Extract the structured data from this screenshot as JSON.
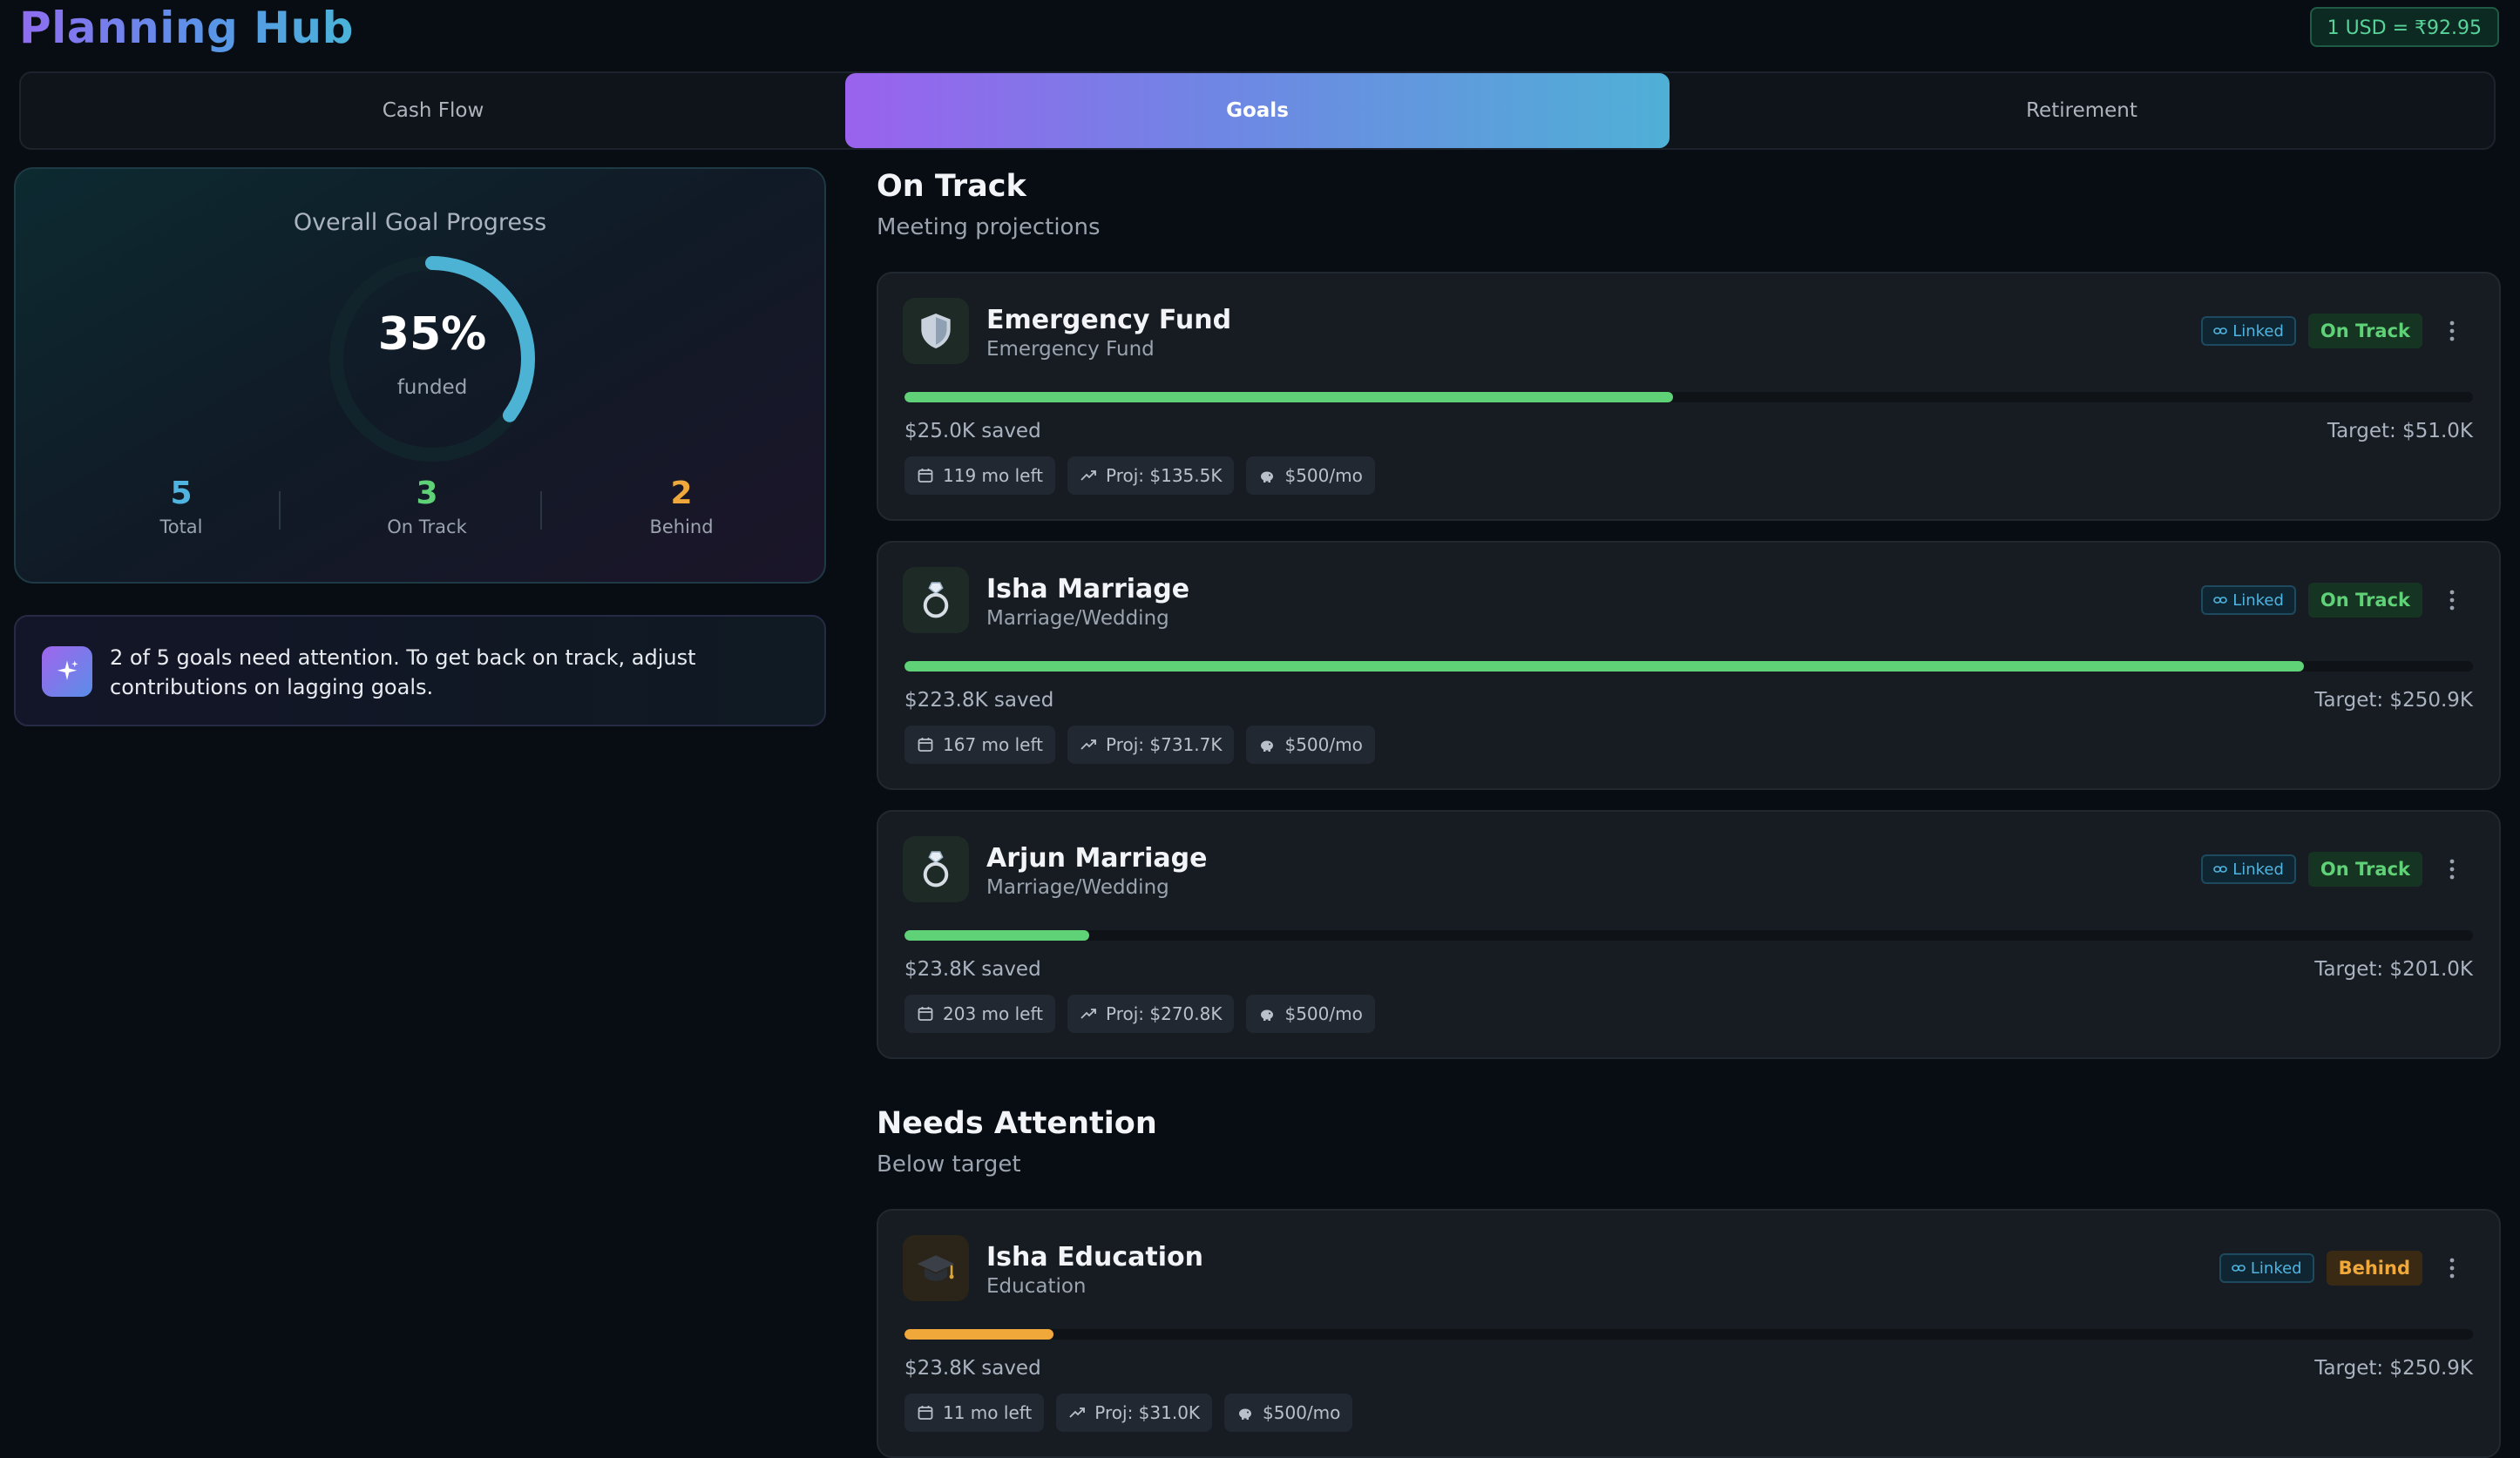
{
  "app": {
    "title": "Planning Hub",
    "fx_rate": "1 USD = ₹92.95"
  },
  "tabs": [
    {
      "label": "Cash Flow",
      "active": false
    },
    {
      "label": "Goals",
      "active": true
    },
    {
      "label": "Retirement",
      "active": false
    }
  ],
  "overview": {
    "title": "Overall Goal Progress",
    "percent_label": "35%",
    "percent_value": 35,
    "funded_label": "funded",
    "stats": [
      {
        "value": "5",
        "label": "Total",
        "color": "#4fb4e0"
      },
      {
        "value": "3",
        "label": "On Track",
        "color": "#5fd177"
      },
      {
        "value": "2",
        "label": "Behind",
        "color": "#f0a83a"
      }
    ]
  },
  "insight": {
    "text": "2 of 5 goals need attention. To get back on track, adjust contributions on lagging goals."
  },
  "sections": {
    "on_track": {
      "title": "On Track",
      "subtitle": "Meeting projections"
    },
    "attention": {
      "title": "Needs Attention",
      "subtitle": "Below target"
    }
  },
  "goals": [
    {
      "name": "Emergency Fund",
      "category": "Emergency Fund",
      "icon": "shield-icon",
      "linked": "Linked",
      "status": "On Track",
      "progress": 0.49,
      "saved": "$25.0K saved",
      "target": "Target: $51.0K",
      "months": "119 mo left",
      "proj": "Proj: $135.5K",
      "monthly": "$500/mo",
      "color": "#5fd177"
    },
    {
      "name": "Isha Marriage",
      "category": "Marriage/Wedding",
      "icon": "ring-icon",
      "linked": "Linked",
      "status": "On Track",
      "progress": 0.892,
      "saved": "$223.8K saved",
      "target": "Target: $250.9K",
      "months": "167 mo left",
      "proj": "Proj: $731.7K",
      "monthly": "$500/mo",
      "color": "#5fd177"
    },
    {
      "name": "Arjun Marriage",
      "category": "Marriage/Wedding",
      "icon": "ring-icon",
      "linked": "Linked",
      "status": "On Track",
      "progress": 0.118,
      "saved": "$23.8K saved",
      "target": "Target: $201.0K",
      "months": "203 mo left",
      "proj": "Proj: $270.8K",
      "monthly": "$500/mo",
      "color": "#5fd177"
    },
    {
      "name": "Isha Education",
      "category": "Education",
      "icon": "graduation-cap-icon",
      "linked": "Linked",
      "status": "Behind",
      "progress": 0.095,
      "saved": "$23.8K saved",
      "target": "Target: $250.9K",
      "months": "11 mo left",
      "proj": "Proj: $31.0K",
      "monthly": "$500/mo",
      "color": "#f0a83a"
    }
  ]
}
